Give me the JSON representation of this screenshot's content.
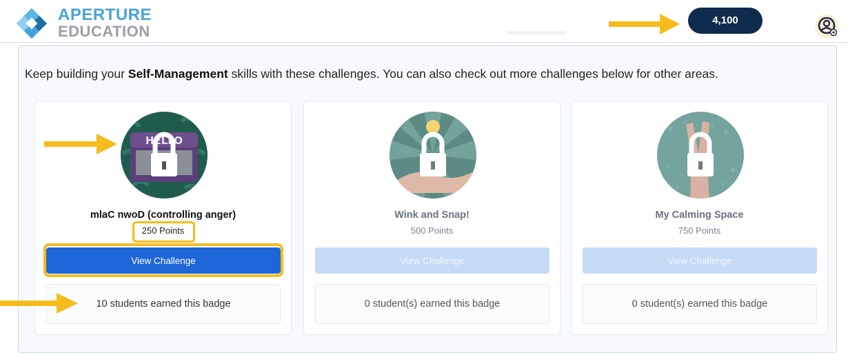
{
  "header": {
    "brand_top": "APERTURE",
    "brand_bottom": "EDUCATION",
    "points_total": "4,100"
  },
  "intro": {
    "prefix": "Keep building your ",
    "highlight": "Self-Management",
    "suffix": " skills with these challenges. You can also check out more challenges below for other areas."
  },
  "cards": [
    {
      "title": "mlaC nwoD (controlling anger)",
      "points": "250 Points",
      "button": "View Challenge",
      "earned": "10 students earned this badge",
      "badge_icon": "hello-name-tag-lock-icon",
      "locked": true
    },
    {
      "title": "Wink and Snap!",
      "points": "500 Points",
      "button": "View Challenge",
      "earned": "0 student(s) earned this badge",
      "badge_icon": "wink-hand-lock-icon",
      "locked": true
    },
    {
      "title": "My Calming Space",
      "points": "750 Points",
      "button": "View Challenge",
      "earned": "0 student(s) earned this badge",
      "badge_icon": "peace-hand-lock-icon",
      "locked": true
    }
  ],
  "colors": {
    "primary_button": "#1f66d9",
    "disabled_button": "#c6d9f5",
    "points_pill": "#0f2b4d",
    "annotation": "#f6bb1c",
    "brand_blue": "#4aa3d6"
  }
}
